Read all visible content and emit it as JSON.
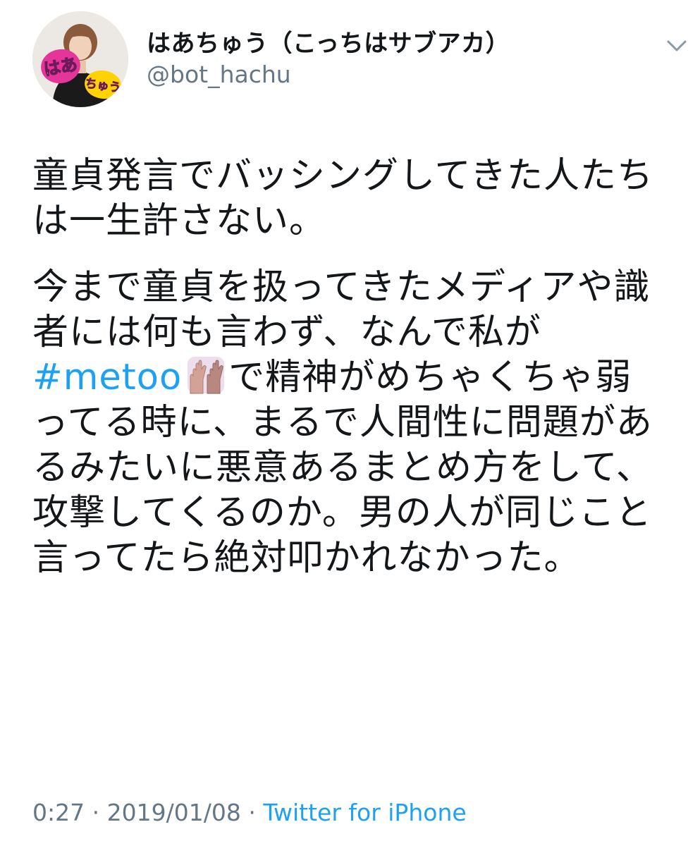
{
  "author": {
    "display_name": "はあちゅう（こっちはサブアカ）",
    "handle": "@bot_hachu",
    "avatar_sign_top": "はあ",
    "avatar_sign_bottom": "ちゅう"
  },
  "tweet": {
    "p1": "童貞発言でバッシングしてきた人たちは一生許さない。",
    "p2_before_hashtag": "今まで童貞を扱ってきたメディアや識者には何も言わず、なんで私が",
    "hashtag": "#metoo",
    "emoji": "raised-hands-emoji",
    "p2_after_hashtag": "で精神がめちゃくちゃ弱ってる時に、まるで人間性に問題があるみたいに悪意あるまとめ方をして、攻撃してくるのか。男の人が同じこと言ってたら絶対叩かれなかった。"
  },
  "meta": {
    "time": "0:27",
    "separator1": "·",
    "date": "2019/01/08",
    "separator2": "·",
    "source": "Twitter for iPhone"
  },
  "colors": {
    "link": "#1da1f2",
    "muted": "#657786",
    "text": "#14171a"
  },
  "icons": {
    "menu": "chevron-down-icon"
  }
}
